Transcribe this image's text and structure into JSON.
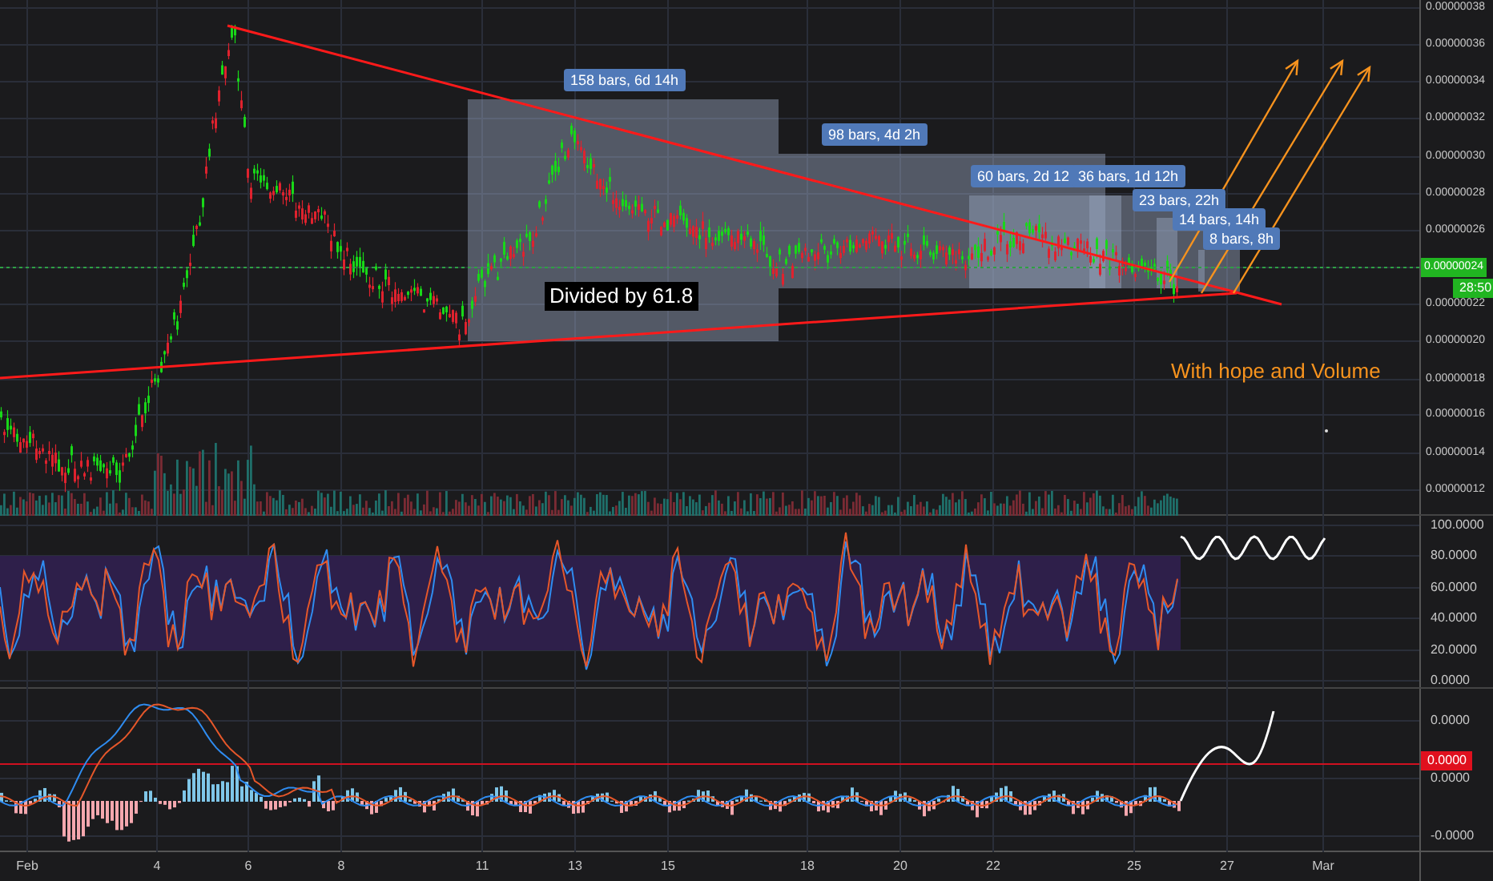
{
  "price_axis": {
    "labels": [
      "0.00000038",
      "0.00000036",
      "0.00000034",
      "0.00000032",
      "0.00000030",
      "0.00000028",
      "0.00000026",
      "0.00000022",
      "0.00000020",
      "0.00000018",
      "0.00000016",
      "0.00000014",
      "0.00000012"
    ],
    "last_price": "0.00000024",
    "countdown": "28:50"
  },
  "annotations": {
    "ranges": [
      {
        "label": "158 bars, 6d 14h"
      },
      {
        "label": "98 bars, 4d 2h"
      },
      {
        "label": "60 bars, 2d 12"
      },
      {
        "label": "36 bars, 1d 12h"
      },
      {
        "label": "23 bars, 22h"
      },
      {
        "label": "14 bars, 14h"
      },
      {
        "label": "8 bars, 8h"
      }
    ],
    "note": "Divided by 61.8",
    "caption": "With hope and Volume"
  },
  "oscillator_axis": {
    "labels": [
      "100.0000",
      "80.0000",
      "60.0000",
      "40.0000",
      "20.0000",
      "0.0000"
    ]
  },
  "macd_axis": {
    "labels": [
      "0.0000",
      "0.0000",
      "-0.0000"
    ],
    "last_value": "0.0000"
  },
  "time_axis": {
    "labels": [
      "Feb",
      "4",
      "6",
      "8",
      "11",
      "13",
      "15",
      "18",
      "20",
      "22",
      "25",
      "27",
      "Mar"
    ]
  }
}
